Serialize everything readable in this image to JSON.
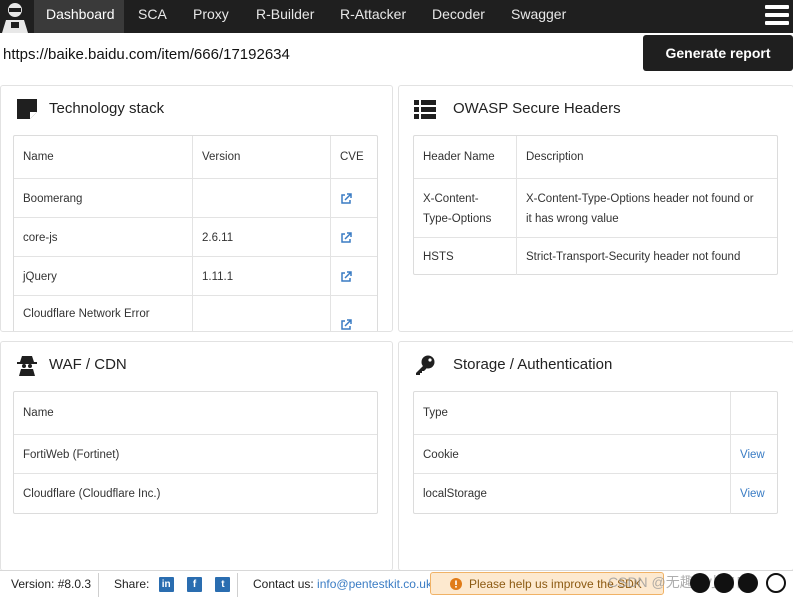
{
  "nav": {
    "tabs": [
      "Dashboard",
      "SCA",
      "Proxy",
      "R-Builder",
      "R-Attacker",
      "Decoder",
      "Swagger"
    ],
    "active": "Dashboard"
  },
  "url": "https://baike.baidu.com/item/666/17192634",
  "generate_report": "Generate report",
  "tech_stack": {
    "title": "Technology stack",
    "headers": [
      "Name",
      "Version",
      "CVE"
    ],
    "rows": [
      {
        "name": "Boomerang",
        "version": ""
      },
      {
        "name": "core-js",
        "version": "2.6.11"
      },
      {
        "name": "jQuery",
        "version": "1.11.1"
      },
      {
        "name": "Cloudflare Network Error",
        "version": ""
      }
    ]
  },
  "owasp": {
    "title": "OWASP Secure Headers",
    "headers": [
      "Header Name",
      "Description"
    ],
    "rows": [
      {
        "name_line1": "X-Content-",
        "name_line2": "Type-Options",
        "desc_line1": "X-Content-Type-Options header not found or",
        "desc_line2": "it has wrong value"
      },
      {
        "name_line1": "HSTS",
        "name_line2": "",
        "desc_line1": "Strict-Transport-Security header not found",
        "desc_line2": ""
      }
    ]
  },
  "waf": {
    "title": "WAF / CDN",
    "header": "Name",
    "rows": [
      "FortiWeb (Fortinet)",
      "Cloudflare (Cloudflare Inc.)"
    ]
  },
  "storage": {
    "title": "Storage / Authentication",
    "header": "Type",
    "rows": [
      {
        "type": "Cookie",
        "action": "View"
      },
      {
        "type": "localStorage",
        "action": "View"
      }
    ]
  },
  "footer": {
    "version": "Version: #8.0.3",
    "share": "Share:",
    "contact_label": "Contact us:",
    "contact_email": "info@pentestkit.co.uk",
    "notice": "Please help us improve the SDK",
    "watermark": "CSDN @无趣的小白白"
  },
  "colors": {
    "nav_bg": "#1f1f1f",
    "link": "#3a7cc4",
    "notice_bg": "#fde9cf"
  }
}
